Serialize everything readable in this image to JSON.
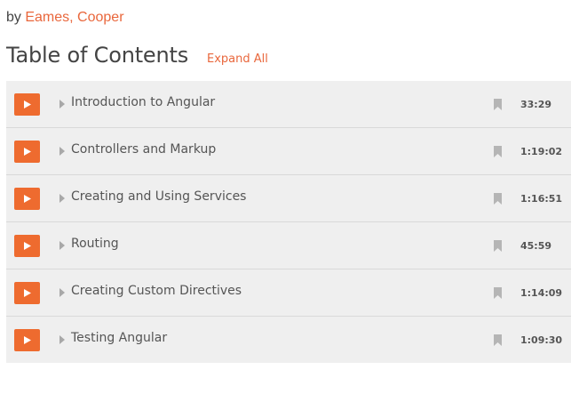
{
  "author": {
    "prefix": "by",
    "names": [
      "Eames",
      "Cooper"
    ],
    "separator": ", "
  },
  "toc": {
    "title": "Table of Contents",
    "expand_all_label": "Expand All",
    "modules": [
      {
        "title": "Introduction to Angular",
        "duration": "33:29"
      },
      {
        "title": "Controllers and Markup",
        "duration": "1:19:02"
      },
      {
        "title": "Creating and Using Services",
        "duration": "1:16:51"
      },
      {
        "title": "Routing",
        "duration": "45:59"
      },
      {
        "title": "Creating Custom Directives",
        "duration": "1:14:09"
      },
      {
        "title": "Testing Angular",
        "duration": "1:09:30"
      }
    ]
  },
  "icons": {
    "play": "play-icon",
    "caret": "caret-right-icon",
    "bookmark": "bookmark-icon"
  },
  "colors": {
    "accent": "#e9673c",
    "play_button": "#ee6b2f",
    "row_background": "#efefef",
    "divider": "#d9d9d9",
    "icon_gray": "#b5b5b5"
  }
}
